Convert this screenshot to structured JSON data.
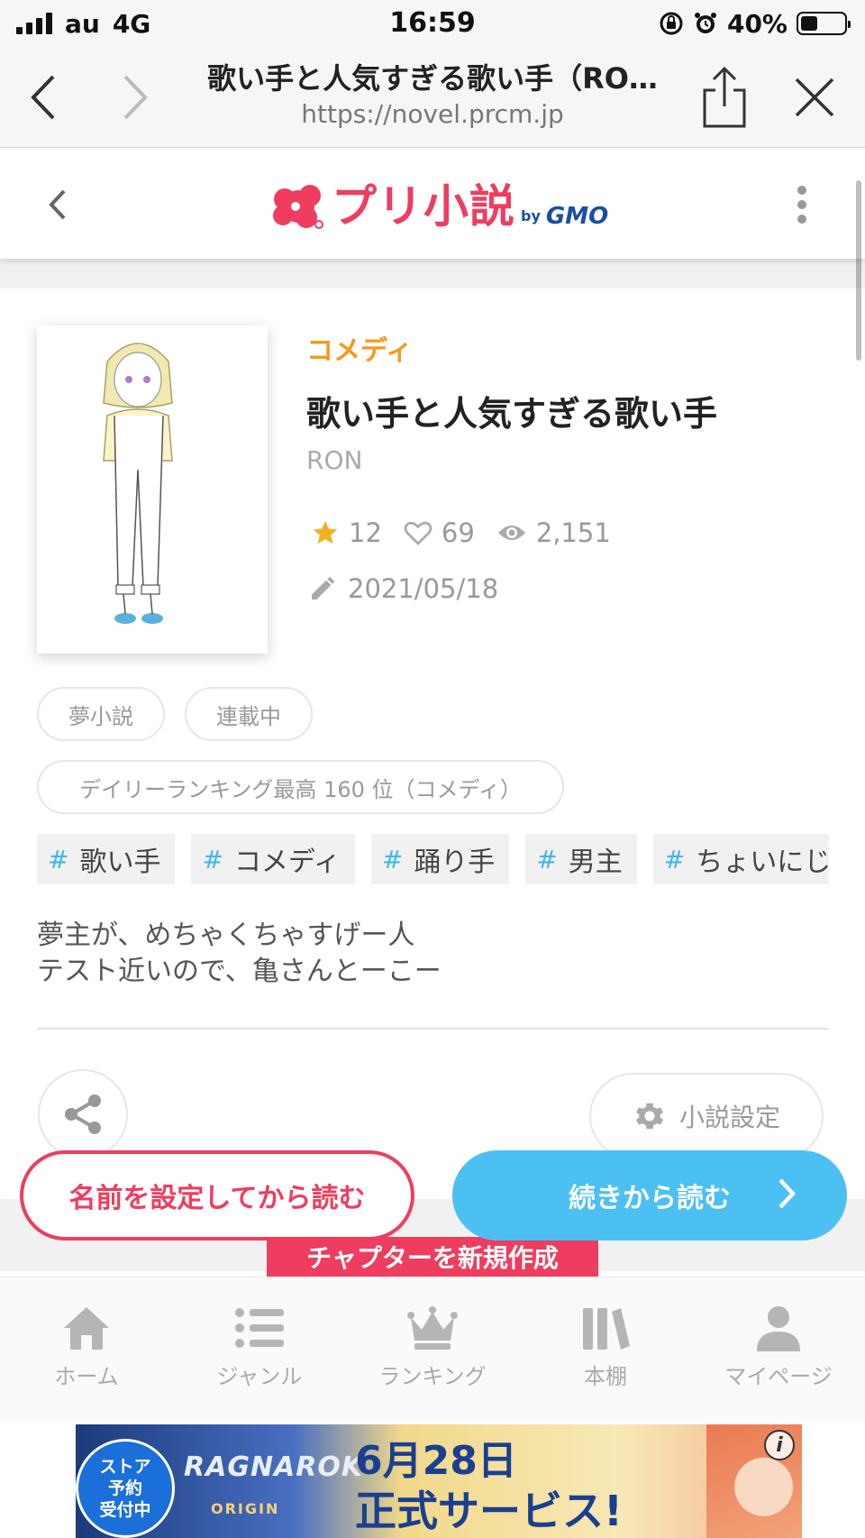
{
  "status_bar": {
    "carrier": "au",
    "network": "4G",
    "time": "16:59",
    "battery_percent": "40%",
    "battery_level": 0.4
  },
  "browser": {
    "page_title": "歌い手と人気すぎる歌い手（RO…",
    "url": "https://novel.prcm.jp"
  },
  "site": {
    "logo_text": "プリ小説",
    "logo_by": "by",
    "logo_brand": "GMO",
    "brand_color": "#ee3d5f"
  },
  "novel": {
    "genre": "コメディ",
    "title": "歌い手と人気すぎる歌い手",
    "author": "RON",
    "stars": "12",
    "likes": "69",
    "views": "2,151",
    "updated": "2021/05/18",
    "chips": [
      "夢小説",
      "連載中"
    ],
    "ranking": "デイリーランキング最高 160 位（コメディ）",
    "tags": [
      "歌い手",
      "コメディ",
      "踊り手",
      "男主",
      "ちょいにじさん"
    ],
    "description": [
      "夢主が、めちゃくちゃすげー人",
      "テスト近いので、亀さんとーこー"
    ]
  },
  "actions": {
    "settings_label": "小説設定",
    "read_with_name": "名前を設定してから読む",
    "read_continue": "続きから読む",
    "new_chapter": "チャプターを新規作成"
  },
  "bottom_nav": [
    {
      "label": "ホーム",
      "icon": "home-icon"
    },
    {
      "label": "ジャンル",
      "icon": "list-icon"
    },
    {
      "label": "ランキング",
      "icon": "crown-icon"
    },
    {
      "label": "本棚",
      "icon": "bookshelf-icon"
    },
    {
      "label": "マイページ",
      "icon": "person-icon"
    }
  ],
  "ad": {
    "badge": [
      "ストア",
      "予約",
      "受付中"
    ],
    "logo": "RAGNAROK",
    "logo_sub": "ORIGIN",
    "date": "6月28日",
    "service": "正式サービス!",
    "info": "i"
  },
  "colors": {
    "genre": "#f39a1c",
    "tag_hash": "#40b7f0",
    "continue_button": "#4cc0f3"
  }
}
